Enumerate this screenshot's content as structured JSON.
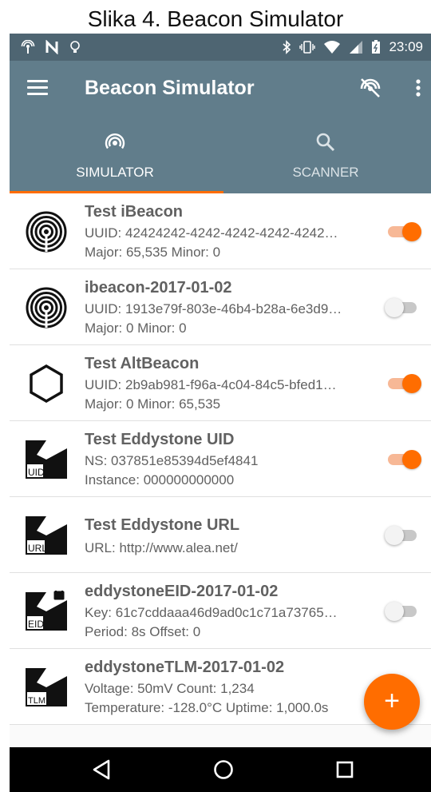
{
  "caption": "Slika 4. Beacon Simulator",
  "status_bar": {
    "time": "23:09",
    "left_icons": [
      "nfc-broadcast-icon",
      "n-icon",
      "bulb-icon"
    ],
    "right_icons": [
      "bluetooth-icon",
      "vibrate-icon",
      "wifi-icon",
      "signal-icon",
      "battery-icon"
    ]
  },
  "app_bar": {
    "title": "Beacon Simulator",
    "actions": [
      "broadcast-off-icon",
      "overflow-menu-icon"
    ]
  },
  "tabs": [
    {
      "label": "SIMULATOR",
      "icon": "broadcast-icon",
      "selected": true
    },
    {
      "label": "SCANNER",
      "icon": "search-icon",
      "selected": false
    }
  ],
  "colors": {
    "app_bar": "#617d8b",
    "status_bar": "#4e6572",
    "accent": "#ff6d00",
    "text": "#616161"
  },
  "beacons": [
    {
      "name": "Test iBeacon",
      "line1": "UUID: 42424242-4242-4242-4242-4242…",
      "line2": "Major: 65,535 Minor: 0",
      "icon": "ibeacon-icon",
      "enabled": true
    },
    {
      "name": "ibeacon-2017-01-02",
      "line1": "UUID: 1913e79f-803e-46b4-b28a-6e3d9…",
      "line2": "Major: 0 Minor: 0",
      "icon": "ibeacon-icon",
      "enabled": false
    },
    {
      "name": "Test AltBeacon",
      "line1": "UUID: 2b9ab981-f96a-4c04-84c5-bfed1…",
      "line2": "Major: 0 Minor: 65,535",
      "icon": "altbeacon-icon",
      "enabled": true
    },
    {
      "name": "Test Eddystone UID",
      "line1": "NS: 037851e85394d5ef4841",
      "line2": "Instance: 000000000000",
      "icon": "eddystone-uid-icon",
      "badge": "UID",
      "enabled": true
    },
    {
      "name": "Test Eddystone URL",
      "line1": "URL: http://www.alea.net/",
      "line2": "",
      "icon": "eddystone-url-icon",
      "badge": "URL",
      "enabled": false
    },
    {
      "name": "eddystoneEID-2017-01-02",
      "line1": "Key: 61c7cddaaa46d9ad0c1c71a73765…",
      "line2": "Period: 8s Offset: 0",
      "icon": "eddystone-eid-icon",
      "badge": "EID",
      "enabled": false
    },
    {
      "name": "eddystoneTLM-2017-01-02",
      "line1": "Voltage: 50mV Count: 1,234",
      "line2": "Temperature: -128.0°C Uptime: 1,000.0s",
      "icon": "eddystone-tlm-icon",
      "badge": "TLM",
      "enabled": null
    }
  ],
  "fab": {
    "label": "+",
    "icon": "add-icon"
  },
  "nav_bar": [
    "back-icon",
    "home-icon",
    "recents-icon"
  ]
}
